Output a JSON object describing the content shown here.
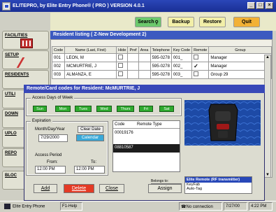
{
  "window": {
    "title": "ELITEPRO, by Elite Entry Phone® ( PRO ) VERSION 4.0.1"
  },
  "toolbar": {
    "search_label": "Search",
    "backup_label": "Backup",
    "restore_label": "Restore",
    "quit_label": "Quit"
  },
  "sidebar": {
    "items": [
      {
        "label": "FACILITIES"
      },
      {
        "label": "SETUP"
      },
      {
        "label": "RESIDENTS"
      },
      {
        "label": "UTILI"
      },
      {
        "label": "DOWN"
      },
      {
        "label": "UPLO"
      },
      {
        "label": "REPO"
      },
      {
        "label": "BLOC"
      }
    ]
  },
  "listing": {
    "header": "Resident listing  ( Z-New Development 2)",
    "columns": [
      "Code",
      "Name (Last, First)",
      "Hide",
      "Pref",
      "Area",
      "Telephone",
      "Key Code",
      "Remote",
      "Group"
    ],
    "rows": [
      {
        "code": "001",
        "name": "LEON, M",
        "telephone": "595-0278",
        "keycode": "001_",
        "remote": false,
        "group": "Manager"
      },
      {
        "code": "002",
        "name": "MCMURTRIE, J",
        "telephone": "595-0278",
        "keycode": "002_",
        "remote": true,
        "group": "Manager"
      },
      {
        "code": "003",
        "name": "ALMANZA, E",
        "telephone": "595-0278",
        "keycode": "003_",
        "remote": false,
        "group": "Group 29"
      }
    ]
  },
  "dialog": {
    "title": "Remote/Card codes for Resident: McMURTRIE, J",
    "access_days_label": "Access Days of Week",
    "days": [
      "Sun",
      "Mon",
      "Tues",
      "Wed",
      "Thurs",
      "Fri",
      "Sat"
    ],
    "expiration_label": "Expiration",
    "date_label": "Month/Day/Year",
    "clear_date_label": "Clear Date",
    "date_value": "7/29/2000",
    "calendar_label": "Calendar",
    "access_period_label": "Access Period",
    "from_label": "From:",
    "to_label": "To:",
    "from_value": "12:00 PM",
    "to_value": "12:00 PM",
    "codes_columns": [
      "Code",
      "Remote Type"
    ],
    "codes": [
      "00019176",
      "08810587"
    ],
    "belongs_to_label": "Belongs to:",
    "remote_types": [
      "Elite Remote (RF transmitter)",
      "KeyFab",
      "Auto-Tag"
    ],
    "add_label": "Add",
    "delete_label": "Delete",
    "close_label": "Close",
    "assign_label": "Assign"
  },
  "status": {
    "app_label": "Elite Entry Phone",
    "help_label": "F1-Help",
    "connection": "No connection",
    "date": "7/27/00",
    "time": "4:22 PM"
  },
  "colors": {
    "titlebar": "#1a2f94",
    "search_button": "#6cc96c",
    "quit_button": "#f2b135",
    "delete_button": "#e43a24",
    "day_button": "#2eaa2e",
    "calendar_button": "#3aa9d8"
  }
}
